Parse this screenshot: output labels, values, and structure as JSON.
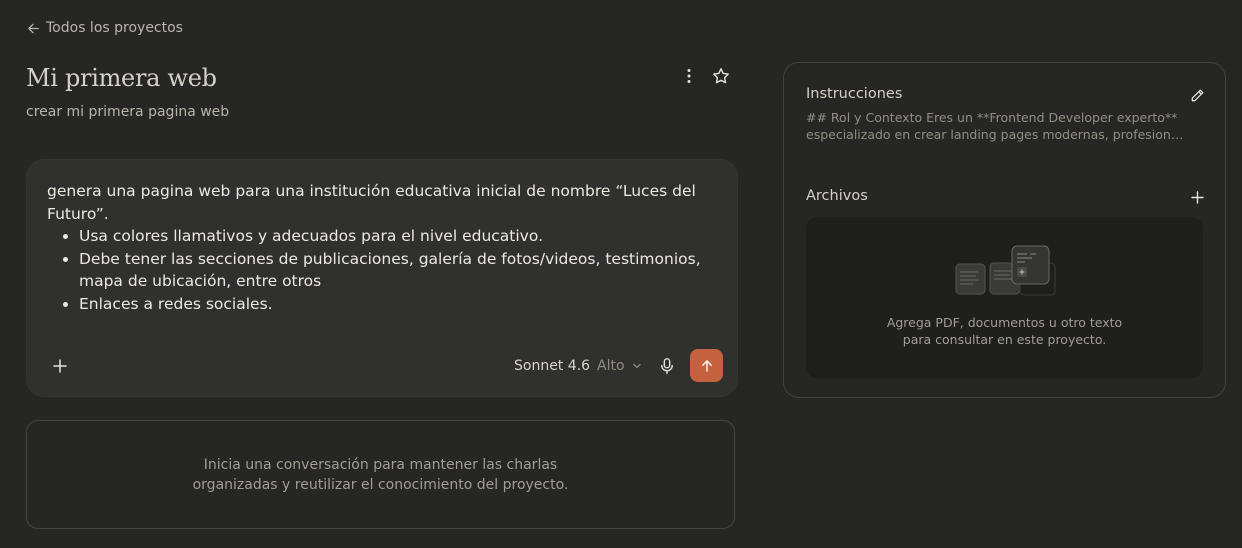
{
  "nav": {
    "back_label": "Todos los proyectos"
  },
  "project": {
    "title": "Mi primera web",
    "description": "crear mi primera pagina web"
  },
  "composer": {
    "prompt_intro": "genera una pagina web para una institución educativa inicial de nombre “Luces del Futuro”.",
    "bullets": [
      "Usa colores llamativos y adecuados para el nivel educativo.",
      "Debe tener las secciones de publicaciones,  galería de fotos/videos, testimonios, mapa de ubicación, entre otros",
      "Enlaces a redes sociales."
    ],
    "model_name": "Sonnet 4.6",
    "effort": "Alto"
  },
  "conversations": {
    "empty_line1": "Inicia una conversación para mantener las charlas",
    "empty_line2": "organizadas y reutilizar el conocimiento del proyecto."
  },
  "instructions": {
    "title": "Instrucciones",
    "preview_line1": "## Rol y Contexto Eres un **Frontend Developer experto**",
    "preview_line2": "especializado en crear landing pages modernas, profesionales y persuasivas"
  },
  "files": {
    "title": "Archivos",
    "empty_line1": "Agrega PDF, documentos u otro texto",
    "empty_line2": "para consultar en este proyecto."
  },
  "colors": {
    "background": "#262624",
    "composer": "#30302e",
    "accent": "#c4613f",
    "dropzone": "#1f1f1d"
  },
  "icons": {
    "back": "arrow-left-icon",
    "menu": "more-vertical-icon",
    "favorite": "star-icon",
    "attach": "plus-icon",
    "model": "chevron-down-icon",
    "voice": "microphone-icon",
    "send": "arrow-up-icon",
    "edit": "pencil-icon",
    "add_file": "plus-icon"
  }
}
